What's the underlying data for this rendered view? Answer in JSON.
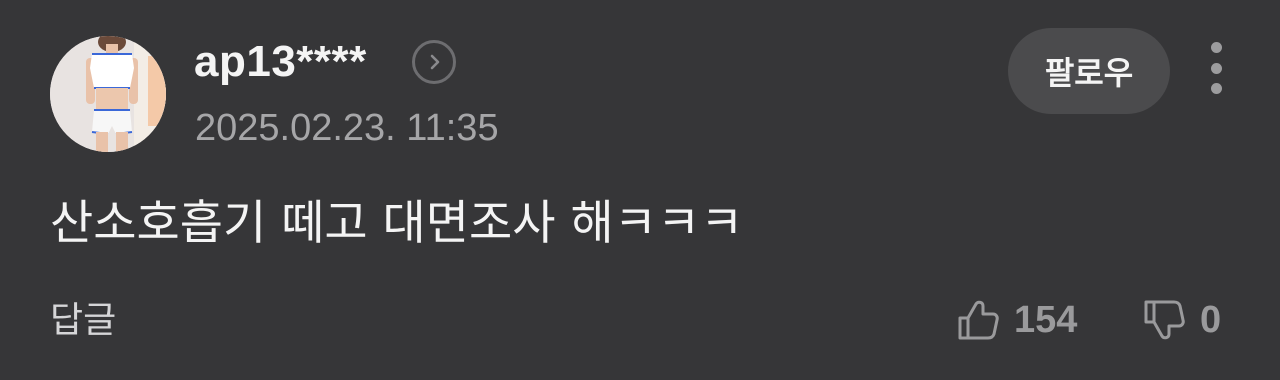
{
  "comment": {
    "username": "ap13****",
    "timestamp": "2025.02.23. 11:35",
    "follow_label": "팔로우",
    "text": "산소호흡기 떼고 대면조사 해ㅋㅋㅋ",
    "reply_label": "답글",
    "likes": "154",
    "dislikes": "0"
  },
  "icons": {
    "profile_link": "chevron-right-circle-icon",
    "more": "more-vertical-icon",
    "like": "thumbs-up-icon",
    "dislike": "thumbs-down-icon"
  },
  "colors": {
    "background": "#363638",
    "text_primary": "#f4f4f4",
    "text_secondary": "#a6a6a8",
    "button_bg": "#4b4b4d"
  }
}
